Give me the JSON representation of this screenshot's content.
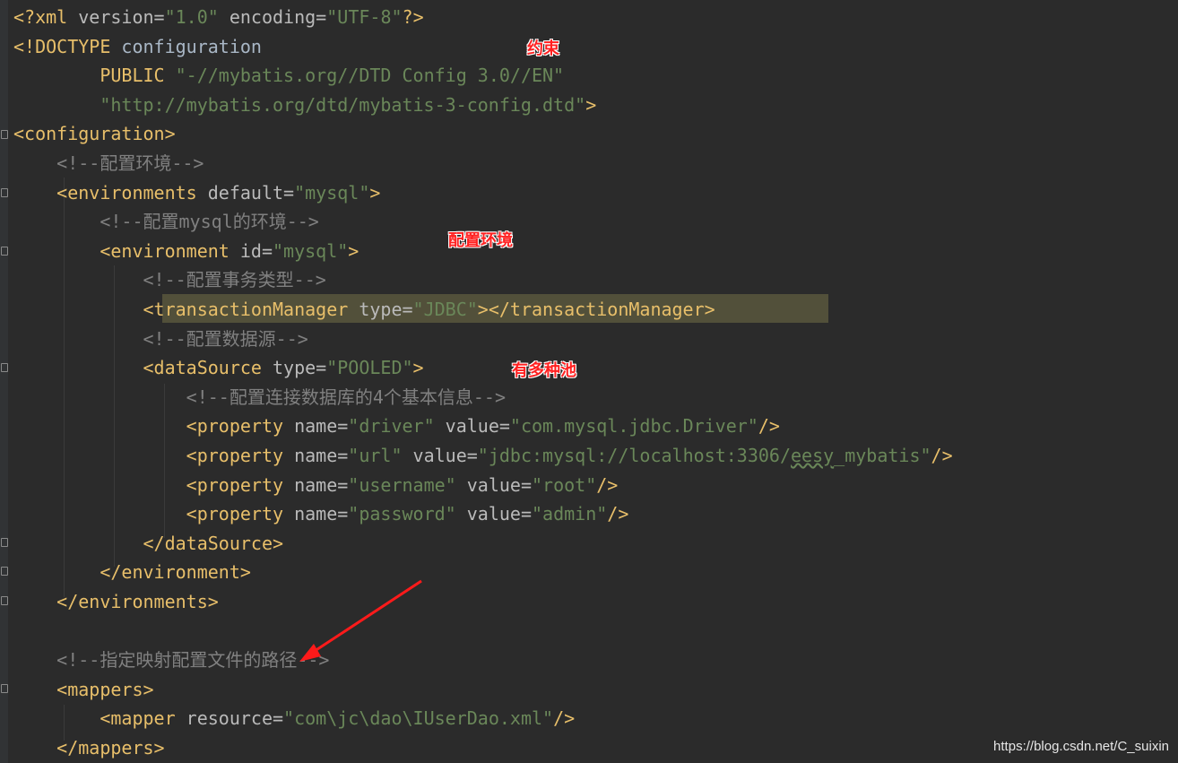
{
  "lines": [
    {
      "segments": [
        {
          "c": "tag",
          "t": "<?xml"
        },
        {
          "c": "attr",
          "t": " version="
        },
        {
          "c": "val",
          "t": "\"1.0\""
        },
        {
          "c": "attr",
          "t": " encoding="
        },
        {
          "c": "val",
          "t": "\"UTF-8\""
        },
        {
          "c": "tag",
          "t": "?>"
        }
      ]
    },
    {
      "segments": [
        {
          "c": "tag",
          "t": "<!DOCTYPE"
        },
        {
          "c": "plain",
          "t": " configuration"
        }
      ]
    },
    {
      "segments": [
        {
          "c": "tag",
          "t": "        PUBLIC "
        },
        {
          "c": "val",
          "t": "\"-//mybatis.org//DTD Config 3.0//EN\""
        }
      ]
    },
    {
      "segments": [
        {
          "c": "val",
          "t": "        \"http://mybatis.org/dtd/mybatis-3-config.dtd\""
        },
        {
          "c": "tag",
          "t": ">"
        }
      ]
    },
    {
      "segments": [
        {
          "c": "tag",
          "t": "<configuration>"
        }
      ]
    },
    {
      "segments": [
        {
          "c": "comment",
          "t": "    <!--配置环境-->"
        }
      ]
    },
    {
      "segments": [
        {
          "c": "tag",
          "t": "    <environments"
        },
        {
          "c": "attr",
          "t": " default="
        },
        {
          "c": "val",
          "t": "\"mysql\""
        },
        {
          "c": "tag",
          "t": ">"
        }
      ]
    },
    {
      "segments": [
        {
          "c": "comment",
          "t": "        <!--配置mysql的环境-->"
        }
      ]
    },
    {
      "segments": [
        {
          "c": "tag",
          "t": "        <environment"
        },
        {
          "c": "attr",
          "t": " id="
        },
        {
          "c": "val",
          "t": "\"mysql\""
        },
        {
          "c": "tag",
          "t": ">"
        }
      ]
    },
    {
      "segments": [
        {
          "c": "comment",
          "t": "            <!--配置事务类型-->"
        }
      ]
    },
    {
      "segments": [
        {
          "c": "tag",
          "t": "            <transactionManager"
        },
        {
          "c": "attr",
          "t": " type="
        },
        {
          "c": "val",
          "t": "\"JDBC\""
        },
        {
          "c": "tag",
          "t": "></transactionManager>"
        }
      ]
    },
    {
      "segments": [
        {
          "c": "comment",
          "t": "            <!--配置数据源-->"
        }
      ]
    },
    {
      "segments": [
        {
          "c": "tag",
          "t": "            <dataSource"
        },
        {
          "c": "attr",
          "t": " type="
        },
        {
          "c": "val",
          "t": "\"POOLED\""
        },
        {
          "c": "tag",
          "t": ">"
        }
      ]
    },
    {
      "segments": [
        {
          "c": "comment",
          "t": "                <!--配置连接数据库的4个基本信息-->"
        }
      ]
    },
    {
      "segments": [
        {
          "c": "tag",
          "t": "                <property"
        },
        {
          "c": "attr",
          "t": " name="
        },
        {
          "c": "val",
          "t": "\"driver\""
        },
        {
          "c": "attr",
          "t": " value="
        },
        {
          "c": "val",
          "t": "\"com.mysql.jdbc.Driver\""
        },
        {
          "c": "tag",
          "t": "/>"
        }
      ]
    },
    {
      "segments": [
        {
          "c": "tag",
          "t": "                <property"
        },
        {
          "c": "attr",
          "t": " name="
        },
        {
          "c": "val",
          "t": "\"url\""
        },
        {
          "c": "attr",
          "t": " value="
        },
        {
          "c": "val",
          "t": "\"jdbc:mysql://localhost:3306/"
        },
        {
          "c": "val squiggle",
          "t": "eesy"
        },
        {
          "c": "val",
          "t": "_mybatis\""
        },
        {
          "c": "tag",
          "t": "/>"
        }
      ]
    },
    {
      "segments": [
        {
          "c": "tag",
          "t": "                <property"
        },
        {
          "c": "attr",
          "t": " name="
        },
        {
          "c": "val",
          "t": "\"username\""
        },
        {
          "c": "attr",
          "t": " value="
        },
        {
          "c": "val",
          "t": "\"root\""
        },
        {
          "c": "tag",
          "t": "/>"
        }
      ]
    },
    {
      "segments": [
        {
          "c": "tag",
          "t": "                <property"
        },
        {
          "c": "attr",
          "t": " name="
        },
        {
          "c": "val",
          "t": "\"password\""
        },
        {
          "c": "attr",
          "t": " value="
        },
        {
          "c": "val",
          "t": "\"admin\""
        },
        {
          "c": "tag",
          "t": "/>"
        }
      ]
    },
    {
      "segments": [
        {
          "c": "tag",
          "t": "            </dataSource>"
        }
      ]
    },
    {
      "segments": [
        {
          "c": "tag",
          "t": "        </environment>"
        }
      ]
    },
    {
      "segments": [
        {
          "c": "tag",
          "t": "    </environments>"
        }
      ]
    },
    {
      "segments": []
    },
    {
      "segments": [
        {
          "c": "comment",
          "t": "    <!--指定映射配置文件的路径-->"
        }
      ]
    },
    {
      "segments": [
        {
          "c": "tag",
          "t": "    <mappers>"
        }
      ]
    },
    {
      "segments": [
        {
          "c": "tag",
          "t": "        <mapper"
        },
        {
          "c": "attr",
          "t": " resource="
        },
        {
          "c": "val",
          "t": "\"com\\jc\\dao\\IUserDao.xml\""
        },
        {
          "c": "tag",
          "t": "/>"
        }
      ]
    },
    {
      "segments": [
        {
          "c": "tag",
          "t": "    </mappers>"
        }
      ]
    }
  ],
  "annotations": {
    "constraint": "约束",
    "config_env": "配置环境",
    "pools": "有多种池"
  },
  "watermark": "https://blog.csdn.net/C_suixin",
  "colors": {
    "background": "#2b2b2b",
    "tag": "#e8bf6a",
    "attribute": "#bababa",
    "string": "#6a8759",
    "comment": "#808080",
    "annotation": "#ff2020",
    "highlight": "#52503a"
  }
}
